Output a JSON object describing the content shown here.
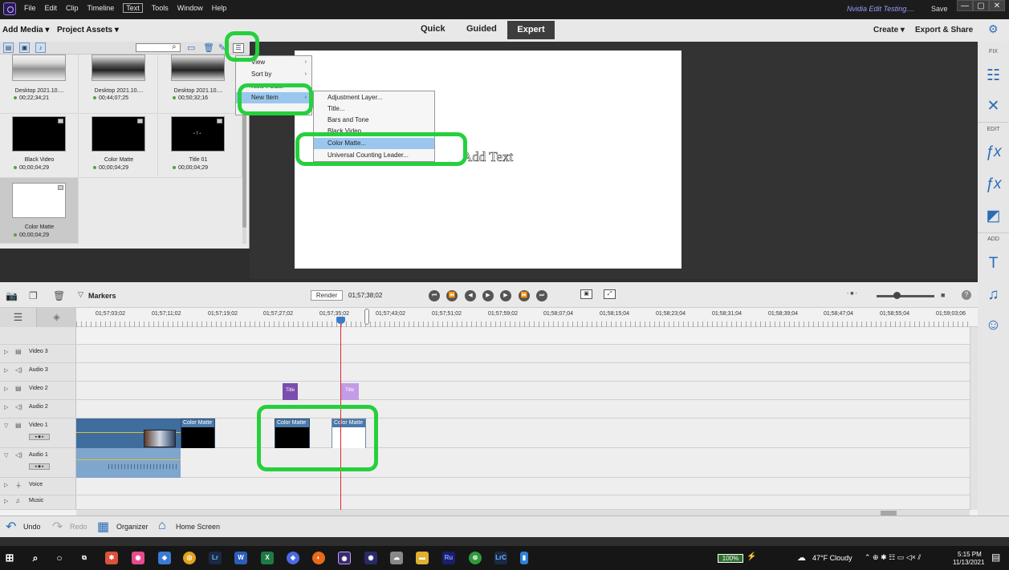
{
  "menubar": {
    "items": [
      "File",
      "Edit",
      "Clip",
      "Timeline",
      "Text",
      "Tools",
      "Window",
      "Help"
    ],
    "active_item": "Text",
    "project_title": "Nvidia Edit Testing....",
    "save_label": "Save",
    "window_controls": [
      "—",
      "▢",
      "✕"
    ]
  },
  "modebar": {
    "add_media": "Add Media ▾",
    "project_assets": "Project Assets ▾",
    "tabs": [
      "Quick",
      "Guided",
      "Expert"
    ],
    "active_tab": "Expert",
    "create": "Create ▾",
    "export_share": "Export & Share"
  },
  "right_panel": {
    "sections": [
      "FIX",
      "EDIT",
      "ADD"
    ],
    "icons": [
      "adjust-sliders-icon",
      "tools-icon",
      "fx-edit-icon",
      "fx-icon",
      "transition-icon",
      "title-text-icon",
      "music-icon",
      "graphics-icon"
    ]
  },
  "assets": {
    "search_placeholder": "",
    "items": [
      {
        "name": "Desktop 2021.10....",
        "duration": "00;22;34;21",
        "kind": "shot"
      },
      {
        "name": "Desktop 2021.10....",
        "duration": "00;44;07;25",
        "kind": "shot2"
      },
      {
        "name": "Desktop 2021.10....",
        "duration": "00;50;32;16",
        "kind": "shot2"
      },
      {
        "name": "Black Video",
        "duration": "00;00;04;29",
        "kind": "black"
      },
      {
        "name": "Color Matte",
        "duration": "00;00;04;29",
        "kind": "black"
      },
      {
        "name": "Title 01",
        "duration": "00;00;04;29",
        "kind": "black"
      },
      {
        "name": "Color Matte",
        "duration": "00;00;04;29",
        "kind": "white"
      }
    ]
  },
  "context_menu": {
    "items": [
      "View",
      "Sort by",
      "New Folder",
      "New Item"
    ],
    "highlighted": "New Item"
  },
  "submenu": {
    "items": [
      "Adjustment Layer...",
      "Title...",
      "Bars and Tone",
      "Black Video",
      "Color Matte...",
      "Universal Counting Leader..."
    ],
    "highlighted": "Color Matte..."
  },
  "monitor": {
    "overlay_text": "Add Text"
  },
  "timeline": {
    "markers_label": "Markers",
    "render_label": "Render",
    "timecode": "01;57;38;02",
    "ruler_ticks": [
      "01;57;03;02",
      "01;57;11;02",
      "01;57;19;02",
      "01;57;27;02",
      "01;57;35;02",
      "01;57;43;02",
      "01;57;51;02",
      "01;57;59;02",
      "01;58;07;04",
      "01;58;15;04",
      "01;58;23;04",
      "01;58;31;04",
      "01;58;39;04",
      "01;58;47;04",
      "01;58;55;04",
      "01;59;03;06"
    ],
    "tracks": [
      "Video 3",
      "Audio 3",
      "Video 2",
      "Audio 2",
      "Video 1",
      "Audio 1",
      "Voice",
      "Music"
    ],
    "clips": {
      "title_a": "Title",
      "title_b": "Title",
      "cm_a": "Color Matte",
      "cm_b": "Color Matte",
      "cm_c": "Color Matte"
    }
  },
  "bottombar": {
    "undo": "Undo",
    "redo": "Redo",
    "organizer": "Organizer",
    "home": "Home Screen"
  },
  "taskbar": {
    "battery": "100%",
    "weather": "47°F  Cloudy",
    "time": "5:15 PM",
    "date": "11/13/2021"
  },
  "colors": {
    "highlight_green": "#25d03c",
    "accent_blue": "#2a6cb6",
    "playhead_red": "#e8232b"
  }
}
